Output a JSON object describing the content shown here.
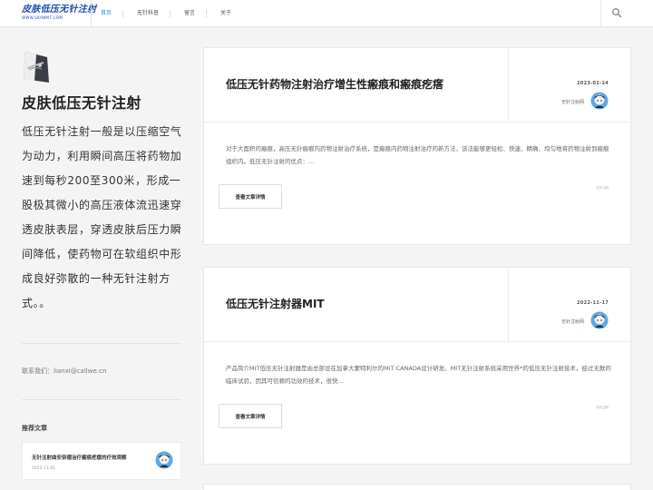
{
  "header": {
    "logo_title": "皮肤低压无针注射",
    "logo_subtitle": "WWW.SKINMIT.COM",
    "nav": [
      {
        "label": "首页",
        "active": true
      },
      {
        "label": "无针科普",
        "active": false
      },
      {
        "label": "留言",
        "active": false
      },
      {
        "label": "关于",
        "active": false
      }
    ],
    "search_icon": "search-icon"
  },
  "sidebar": {
    "site_name": "皮肤低压无针注射",
    "description": "低压无针注射一般是以压缩空气为动力，利用瞬间高压将药物加速到每秒200至300米，形成一股极其微小的高压液体流迅速穿透皮肤表层，穿透皮肤后压力瞬间降低，使药物可在软组织中形成良好弥散的一种无针注射方式。。",
    "contact": "联系我们：lianxi@callwe.cn",
    "recommend_title": "推荐文章",
    "recommend": [
      {
        "title": "无针注射曲安奈德治疗瘢痕疙瘩的疗效观察",
        "date": "2022-11-01"
      }
    ]
  },
  "articles": [
    {
      "title": "低压无针药物注射治疗增生性瘢痕和瘢痕疙瘩",
      "date": "2023-02-24",
      "author": "无针注射网",
      "excerpt": "对于大面积的瘢痕，高压无针瘢痕内药物注射治疗系统，是瘢痕内药物注射治疗的新方法，该法能够更轻松、快速、精确、均匀地将药物注射到瘢痕组织内。低压无针注射的优点：...",
      "button": "查看文章详情",
      "tag": "无针注射"
    },
    {
      "title": "低压无针注射器MIT",
      "date": "2022-11-17",
      "author": "无针注射网",
      "excerpt": "产品简介MIT低压无针注射器是由总部设在加拿大蒙特利尔的MIT CANADA设计研发。MIT无针注射系统采用世界*的低压无针注射技术，经过无数的临床试验，因其可信赖的功效的技术，很快...",
      "button": "查看文章详情",
      "tag": "无针注射"
    }
  ],
  "colors": {
    "accent": "#2f8fe0",
    "logo": "#1f4aa8",
    "background": "#f4f4f4"
  }
}
